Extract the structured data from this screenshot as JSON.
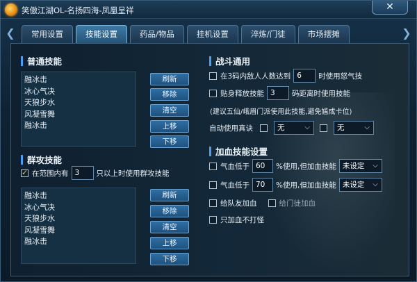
{
  "window": {
    "title": "笑傲江湖OL-名扬四海-凤凰呈祥",
    "close_icon": "close-icon"
  },
  "tabs": [
    "常用设置",
    "技能设置",
    "药品/物品",
    "挂机设置",
    "淬炼/门徒",
    "市场摆摊"
  ],
  "active_tab": "技能设置",
  "normal_skills": {
    "title": "普通技能",
    "items": [
      "融冰击",
      "冰心气决",
      "天狼步水",
      "风凝雪舞",
      "融冰击"
    ],
    "buttons": [
      "刷新",
      "移除",
      "清空",
      "上移",
      "下移"
    ]
  },
  "group_skills": {
    "title": "群攻技能",
    "option": {
      "checked": true,
      "prefix": "在范围内有",
      "value": "3",
      "suffix": "只以上时使用群攻技能"
    },
    "items": [
      "融冰击",
      "冰心气决",
      "天狼步水",
      "风凝雪舞",
      "融冰击"
    ],
    "buttons": [
      "刷新",
      "移除",
      "清空",
      "上移",
      "下移"
    ]
  },
  "combat": {
    "title": "战斗通用",
    "rage": {
      "checked": false,
      "prefix": "在3码内敌人人数达到",
      "value": "6",
      "suffix": "时使用怒气技"
    },
    "close_range": {
      "checked": false,
      "prefix": "贴身释放技能",
      "value": "3",
      "suffix": "码距离时使用技能"
    },
    "note": "(建议五仙/峨眉门派使用此技能,避免尴成卡位)",
    "auto_true_qi": {
      "label": "自动使用真诀",
      "select1": "无",
      "select2": "无",
      "checked1": false,
      "checked2": false
    }
  },
  "heal": {
    "title": "加血技能设置",
    "rows": [
      {
        "checked": false,
        "prefix": "气血低于",
        "value": "60",
        "suffix": "%使用,但加血技能",
        "select": "未设定"
      },
      {
        "checked": false,
        "prefix": "气血低于",
        "value": "70",
        "suffix": "%使用,但加血技能",
        "select": "未设定"
      }
    ],
    "team_heal": {
      "checked": false,
      "label": "给队友加血"
    },
    "disciple_heal": {
      "checked": false,
      "label": "给门徒加血"
    },
    "heal_only": {
      "checked": false,
      "label": "只加血不打怪"
    }
  }
}
